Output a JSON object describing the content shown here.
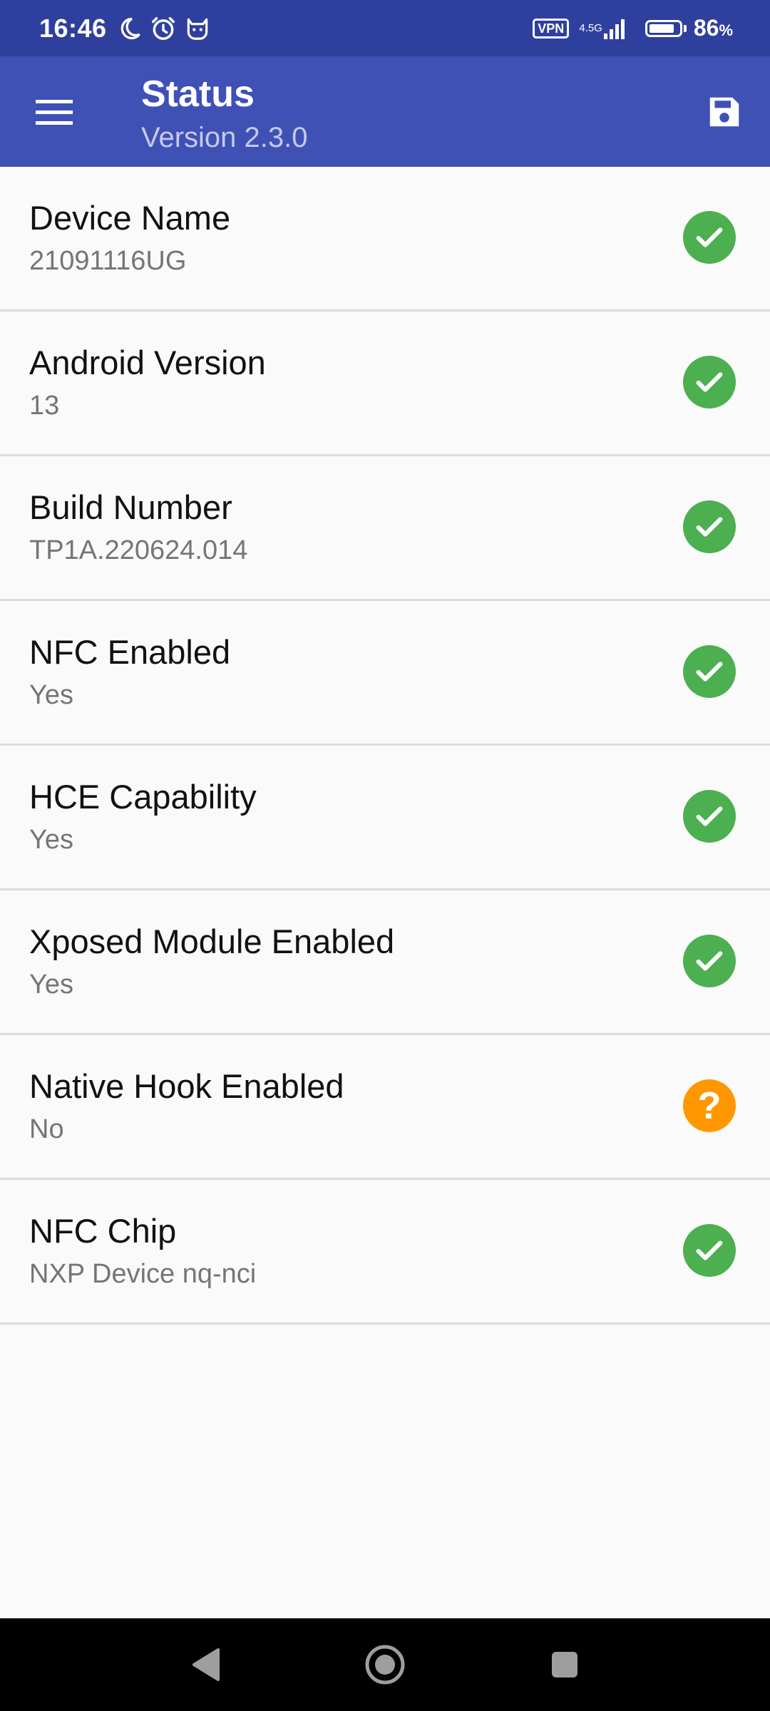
{
  "status_bar": {
    "time": "16:46",
    "icons": [
      "moon-icon",
      "alarm-icon",
      "cat-icon"
    ],
    "vpn": "VPN",
    "network": "4.5G",
    "battery_level": 0.86,
    "battery_text": "86",
    "battery_unit": "%"
  },
  "toolbar": {
    "title": "Status",
    "subtitle": "Version 2.3.0",
    "menu_icon": "hamburger-menu-icon",
    "save_icon": "save-icon"
  },
  "items": [
    {
      "title": "Device Name",
      "value": "21091116UG",
      "status": "ok"
    },
    {
      "title": "Android Version",
      "value": "13",
      "status": "ok"
    },
    {
      "title": "Build Number",
      "value": "TP1A.220624.014",
      "status": "ok"
    },
    {
      "title": "NFC Enabled",
      "value": "Yes",
      "status": "ok"
    },
    {
      "title": "HCE Capability",
      "value": "Yes",
      "status": "ok"
    },
    {
      "title": "Xposed Module Enabled",
      "value": "Yes",
      "status": "ok"
    },
    {
      "title": "Native Hook Enabled",
      "value": "No",
      "status": "warn"
    },
    {
      "title": "NFC Chip",
      "value": "NXP Device nq-nci",
      "status": "ok"
    }
  ],
  "nav": [
    "back-icon",
    "home-icon",
    "recents-icon"
  ],
  "colors": {
    "status_bar": "#2f3f9e",
    "toolbar": "#3f51b5",
    "ok": "#4caf50",
    "warn": "#ff9800"
  }
}
